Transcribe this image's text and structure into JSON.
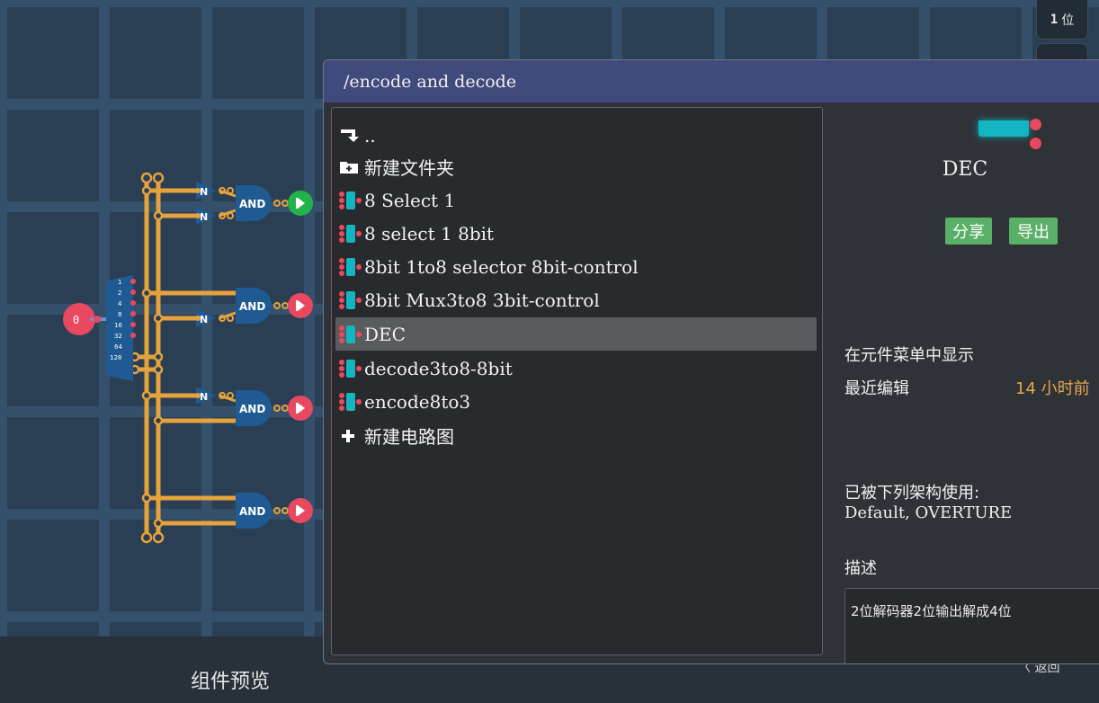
{
  "toolbar": {
    "bits_value": "1",
    "bits_unit": "位"
  },
  "canvas": {
    "input_value": "0",
    "splitter_labels": [
      "1",
      "2",
      "4",
      "8",
      "16",
      "32",
      "64",
      "128"
    ],
    "gate_label": "AND",
    "not_label": "N"
  },
  "bottom_bar": {
    "preview_label": "组件预览",
    "back_label": "〈 返回"
  },
  "dialog": {
    "path": "/encode and decode",
    "items": [
      {
        "label": "..",
        "icon": "up-folder-icon"
      },
      {
        "label": "新建文件夹",
        "icon": "new-folder-icon"
      },
      {
        "label": "8 Select 1",
        "icon": "component-icon"
      },
      {
        "label": "8 select 1 8bit",
        "icon": "component-icon"
      },
      {
        "label": "8bit 1to8 selector 8bit-control",
        "icon": "component-icon"
      },
      {
        "label": "8bit Mux3to8 3bit-control",
        "icon": "component-icon"
      },
      {
        "label": "DEC",
        "icon": "component-icon"
      },
      {
        "label": "decode3to8-8bit",
        "icon": "component-icon"
      },
      {
        "label": "encode8to3",
        "icon": "component-icon"
      },
      {
        "label": "新建电路图",
        "icon": "plus-icon"
      }
    ],
    "selected_index": 6
  },
  "details": {
    "name": "DEC",
    "share_label": "分享",
    "export_label": "导出",
    "show_in_menu_label": "在元件菜单中显示",
    "last_edited_label": "最近编辑",
    "last_edited_value": "14 小时前",
    "used_by_label": "已被下列架构使用:",
    "used_by_value": "Default, OVERTURE",
    "description_label": "描述",
    "description_text": "2位解码器2位输出解成4位"
  },
  "colors": {
    "header": "#414a7c",
    "wire": "#e6a23c",
    "gate": "#1f5a92",
    "output_red": "#e84860",
    "output_green": "#22b44a",
    "button_green": "#5ab067",
    "accent_orange": "#e7a54c"
  }
}
